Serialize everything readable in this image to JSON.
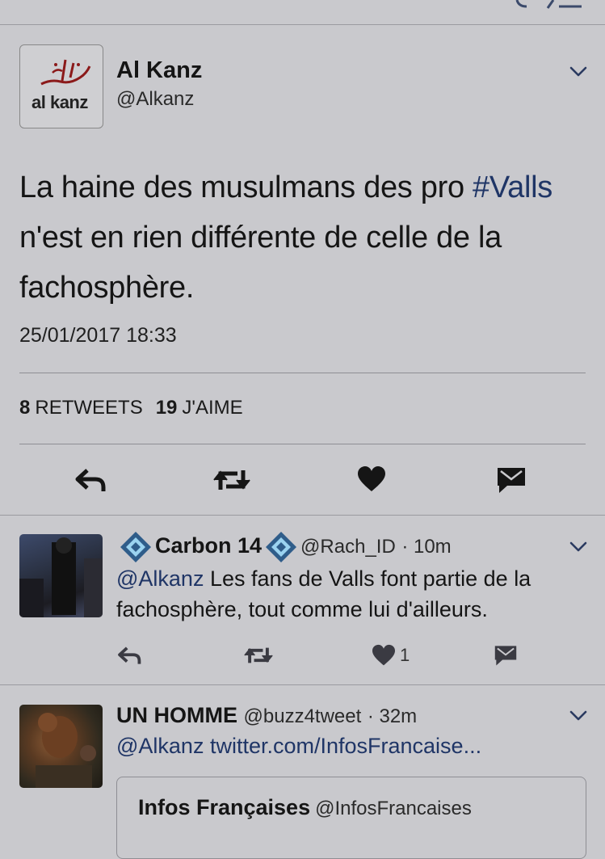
{
  "main_tweet": {
    "avatar_logo_text": "al kanz",
    "author_name": "Al Kanz",
    "author_handle": "@Alkanz",
    "text_before": "La haine des musulmans des pro ",
    "hashtag": "#Valls",
    "text_after": " n'est en rien différente de celle de la fachosphère.",
    "timestamp": "25/01/2017 18:33",
    "retweets_count": "8",
    "retweets_label": "RETWEETS",
    "likes_count": "19",
    "likes_label": "J'AIME"
  },
  "replies": [
    {
      "author_name": "Carbon 14",
      "author_handle": "@Rach_ID",
      "time": "· 10m",
      "mention": "@Alkanz",
      "text": " Les fans de Valls font partie de la fachosphère, tout comme lui d'ailleurs.",
      "like_count": "1"
    },
    {
      "author_name": "UN HOMME",
      "author_handle": "@buzz4tweet",
      "time": "· 32m",
      "mention": "@Alkanz",
      "link": " twitter.com/InfosFrancaise...",
      "quote_name": "Infos Françaises",
      "quote_handle": "@InfosFrancaises"
    }
  ],
  "colors": {
    "background": "#c9c9cd",
    "accent": "#1f3566",
    "icon": "#151515"
  },
  "icons": [
    "reply-icon",
    "retweet-icon",
    "heart-icon",
    "direct-message-icon",
    "chevron-down-icon",
    "verified-diamond-icon"
  ]
}
